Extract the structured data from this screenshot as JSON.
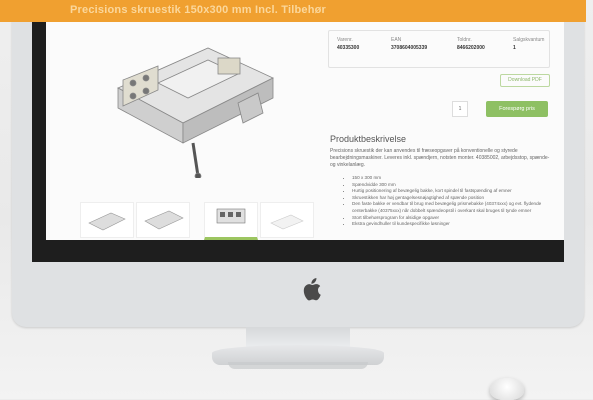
{
  "banner": {
    "title": "",
    "subtitle": "Precisions skruestik 150x300 mm Incl. Tilbehør"
  },
  "product": {
    "attributes": [
      {
        "label": "Varenr.",
        "value": "40335300"
      },
      {
        "label": "EAN",
        "value": "3708604005339"
      },
      {
        "label": "Toldnr.",
        "value": "8466202000"
      },
      {
        "label": "Salgskvantum",
        "value": "1"
      }
    ],
    "download_label": "Download PDF",
    "quantity": "1",
    "price_button": "Forespørg pris",
    "description_title": "Produktbeskrivelse",
    "description_text": "Precisions skruestik der kan anvendes til fræseopgaver på konventionelle og styrede bearbejdningsmaskiner. Leveres inkl. spændjern, notsten monter. 40385002, arbejdsstop, spænde- og vinkelanlæg.",
    "bullets": [
      "150 x 300 mm",
      "Spændvidde 300 mm",
      "Hurtig positionering af bevægelig bakke, kort spindel til fastspænding af emner",
      "Skruestikken har høj gentagelsesnøjagtighed af spænde position",
      "Den faste bakke er vendbar til brug med bevægelig prismebakke (40374xxx) og evt. flydende centerbakke (40375xxx) når dobbelt spændeopstil i overkant skal bruges til tynde emner",
      "Stort tilbehørsprogram for alsidige opgaver",
      "Ekstra gevindhuller til kundespecifikke løsninger"
    ]
  },
  "thumbnails": [
    "Thumbnail 1",
    "Thumbnail 2",
    "Thumbnail 3",
    "Thumbnail 4"
  ]
}
